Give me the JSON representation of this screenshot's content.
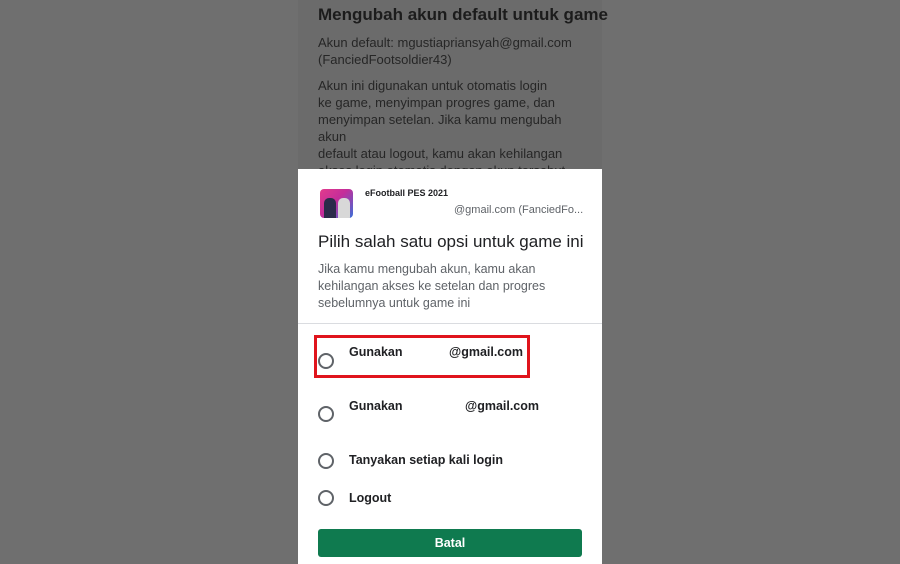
{
  "background": {
    "title": "Mengubah akun default untuk game",
    "default_account": "Akun default: mgustiapriansyah@gmail.com\n(FanciedFootsoldier43)",
    "description": "Akun ini digunakan untuk otomatis login\nke game, menyimpan progres game, dan\nmenyimpan setelan. Jika kamu mengubah akun\ndefault atau logout, kamu akan kehilangan\nakses login otomatis dengan akun tersebut\nuntuk game yang telah kamu mainkan"
  },
  "dialog": {
    "app_name": "eFootball PES 2021",
    "app_account": "@gmail.com (FanciedFo...",
    "title": "Pilih salah satu opsi untuk game ini",
    "description": "Jika kamu mengubah akun, kamu akan kehilangan akses ke setelan dan progres sebelumnya untuk game ini",
    "options": [
      {
        "label": "Gunakan",
        "email": "@gmail.com"
      },
      {
        "label": "Gunakan",
        "email": "@gmail.com"
      },
      {
        "label": "Tanyakan setiap kali login"
      },
      {
        "label": "Logout"
      }
    ],
    "cancel_label": "Batal"
  },
  "colors": {
    "accent_button": "#0f7a4f",
    "highlight_box": "#e0141c"
  }
}
